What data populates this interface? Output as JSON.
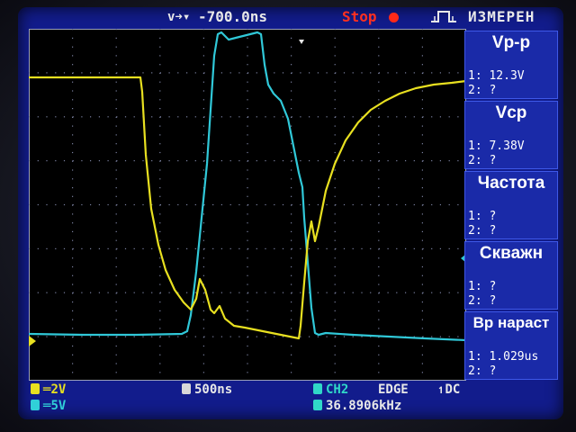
{
  "status": {
    "trigger_position_icon": "v",
    "trigger_time": "-700.0ns",
    "run_state": "Stop",
    "trigger_edge_icon": "rising-edge-icon",
    "menu_title": "ИЗМЕРЕН"
  },
  "measurements": [
    {
      "title": "Vp-p",
      "ch1": "1: 12.3V",
      "ch2": "2:  ?"
    },
    {
      "title": "Vcp",
      "ch1": "1: 7.38V",
      "ch2": "2:  ?"
    },
    {
      "title": "Частота",
      "ch1": "1:  ?",
      "ch2": "2:  ?"
    },
    {
      "title": "Скважн",
      "ch1": "1:  ?",
      "ch2": "2:  ?"
    },
    {
      "title": "Вр нараст",
      "ch1": "1: 1.029us",
      "ch2": "2:  ?"
    }
  ],
  "bottom": {
    "ch1_scale": "2V",
    "ch2_scale": "5V",
    "timebase": "500ns",
    "trigger_source": "CH2",
    "trigger_mode": "EDGE",
    "coupling": "DC",
    "frequency": "36.8906kHz"
  },
  "colors": {
    "ch1": "#e8e020",
    "ch2": "#30d0d8",
    "screen": "#121c8c",
    "stop": "#ff3020"
  }
}
